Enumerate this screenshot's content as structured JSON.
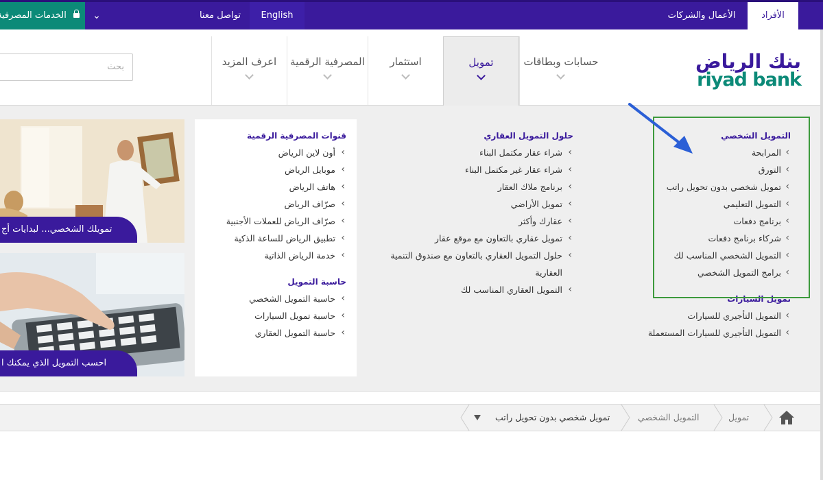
{
  "topbar": {
    "individuals": "الأفراد",
    "business": "الأعمال والشركات",
    "english": "English",
    "contact": "تواصل معنا",
    "online_services": "الخدمات المصرفية"
  },
  "header": {
    "logo_ar": "بنك الرياض",
    "logo_en": "riyad bank",
    "nav": [
      {
        "label": "حسابات وبطاقات"
      },
      {
        "label": "تمويل"
      },
      {
        "label": "استثمار"
      },
      {
        "label": "المصرفية الرقمية"
      },
      {
        "label": "اعرف المزيد"
      }
    ],
    "search_placeholder": "بحث"
  },
  "menu": {
    "personal": {
      "title": "التمويل الشخصي",
      "items": [
        "المرابحة",
        "التورق",
        "تمويل شخصي بدون تحويل راتب",
        "التمويل التعليمي",
        "برنامج دفعات",
        "شركاء برنامج دفعات",
        "التمويل الشخصي المناسب لك",
        "برامج التمويل الشخصي"
      ]
    },
    "auto": {
      "title": "تمويل السيارات",
      "items": [
        "التمويل التأجيري للسيارات",
        "التمويل التأجيري للسيارات المستعملة"
      ]
    },
    "realestate": {
      "title": "حلول التمويل العقاري",
      "items": [
        "شراء عقار مكتمل البناء",
        "شراء عقار غير مكتمل البناء",
        "برنامج ملاك العقار",
        "تمويل الأراضي",
        "عقارك وأكثر",
        "تمويل عقاري بالتعاون مع موقع عقار",
        "حلول التمويل العقاري بالتعاون مع صندوق التنمية",
        "العقارية",
        "التمويل العقاري المناسب لك"
      ]
    },
    "digital": {
      "title": "قنوات المصرفية الرقمية",
      "items": [
        "أون لاين الرياض",
        "موبايل الرياض",
        "هاتف الرياض",
        "صرّاف الرياض",
        "صرّاف الرياض للعملات الأجنبية",
        "تطبيق الرياض للساعة الذكية",
        "خدمة الرياض الذاتية"
      ]
    },
    "calc": {
      "title": "حاسبة التمويل",
      "items": [
        "حاسبة التمويل الشخصي",
        "حاسبة تمويل السيارات",
        "حاسبة التمويل العقاري"
      ]
    }
  },
  "promos": [
    {
      "text": "تمويلك الشخصي... لبدايات أج"
    },
    {
      "text": "احسب التمويل الذي يمكنك ا"
    }
  ],
  "breadcrumb": {
    "level1": "تمويل",
    "level2": "التمويل الشخصي",
    "current": "تمويل شخصي بدون تحويل راتب"
  },
  "colors": {
    "brand_purple": "#3a1a9c",
    "brand_green": "#0c8a78",
    "highlight_green": "#3c9a3c",
    "annotation_arrow": "#2b5fd6"
  }
}
